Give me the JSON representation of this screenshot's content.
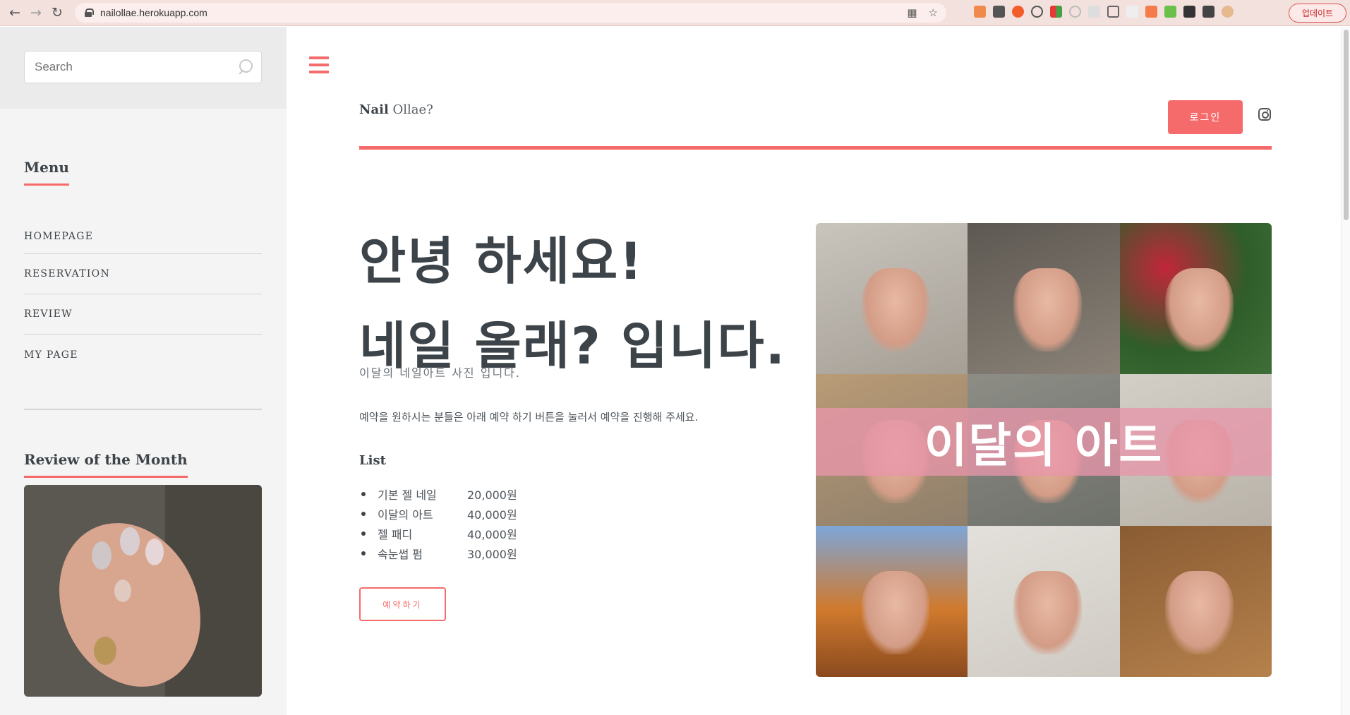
{
  "browser": {
    "url": "nailollae.herokuapp.com",
    "update_label": "업데이트"
  },
  "sidebar": {
    "search_placeholder": "Search",
    "menu_title": "Menu",
    "menu_items": [
      {
        "label": "HOMEPAGE"
      },
      {
        "label": "RESERVATION"
      },
      {
        "label": "REVIEW"
      },
      {
        "label": "MY PAGE"
      }
    ],
    "review_title": "Review of the Month"
  },
  "header": {
    "logo_bold": "Nail",
    "logo_light": "Ollae?",
    "login_label": "로그인"
  },
  "hero": {
    "title_line1": "안녕 하세요!",
    "title_line2": "네일 올래? 입니다.",
    "subtitle": "이달의 네일아트 사진 입니다.",
    "description": "예약을 원하시는 분들은 아래 예약 하기 버튼을 눌러서 예약을 진행해 주세요.",
    "list_title": "List",
    "price_list": [
      {
        "name": "기본 젤 네일",
        "price": "20,000원"
      },
      {
        "name": "이달의 아트",
        "price": "40,000원"
      },
      {
        "name": "젤 패디",
        "price": "40,000원"
      },
      {
        "name": "속눈썹 펌",
        "price": "30,000원"
      }
    ],
    "reserve_label": "예약하기"
  },
  "gallery": {
    "banner_text": "이달의 아트"
  },
  "colors": {
    "accent": "#f56a6a",
    "sidebar_bg": "#f4f4f4",
    "text": "#3d4449"
  }
}
